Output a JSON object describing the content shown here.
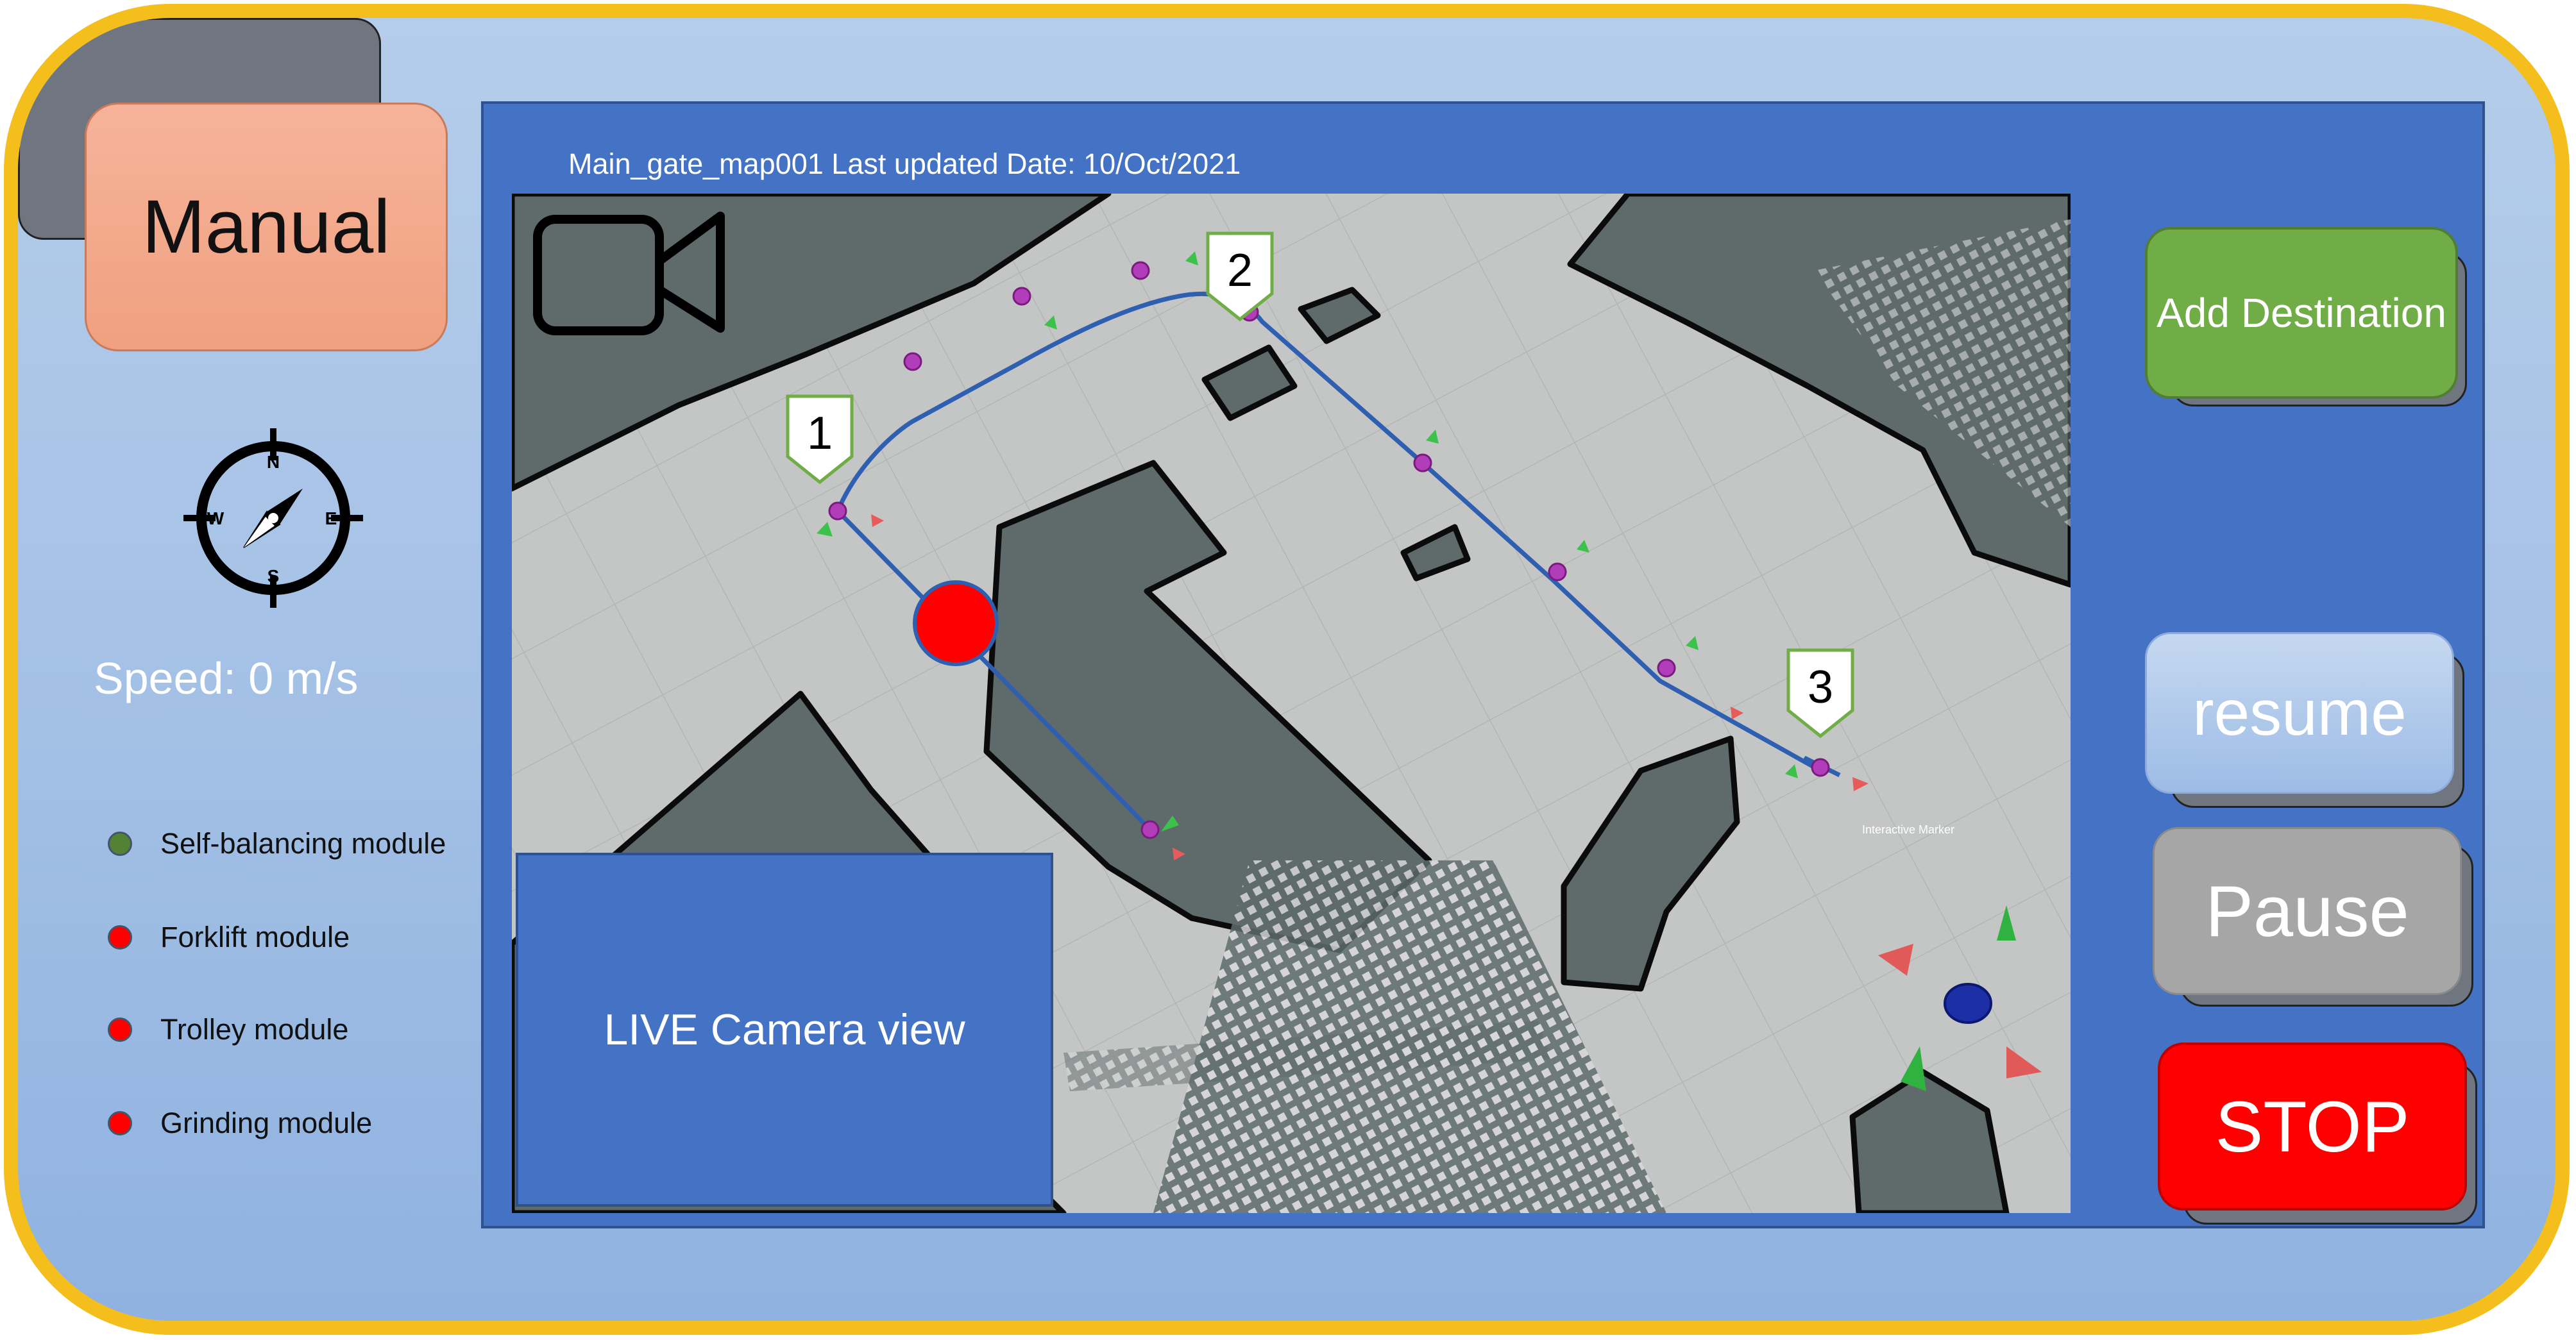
{
  "mode": {
    "label": "Manual"
  },
  "compass": {
    "north": "N",
    "south": "S",
    "east": "E",
    "west": "W"
  },
  "speed": {
    "label": "Speed: 0  m/s"
  },
  "modules": [
    {
      "label": "Self-balancing module",
      "status_color": "#548235"
    },
    {
      "label": "Forklift module",
      "status_color": "#FF0000"
    },
    {
      "label": "Trolley module",
      "status_color": "#FF0000"
    },
    {
      "label": "Grinding module",
      "status_color": "#FF0000"
    }
  ],
  "map": {
    "title": "Main_gate_map001 Last updated Date: 10/Oct/2021",
    "waypoints": [
      "1",
      "2",
      "3"
    ],
    "marker_label": "Interactive Marker",
    "robot_color": "#FF0000",
    "path_color": "#2E5FB0"
  },
  "camera": {
    "label": "LIVE Camera view"
  },
  "actions": {
    "add_destination": "Add Destination",
    "resume": "resume",
    "pause": "Pause",
    "stop": "STOP"
  },
  "colors": {
    "border": "#F4BE1C",
    "panel": "#4472C4",
    "stop": "#FF0000",
    "add": "#70AD47",
    "manual": "#F4A384"
  }
}
